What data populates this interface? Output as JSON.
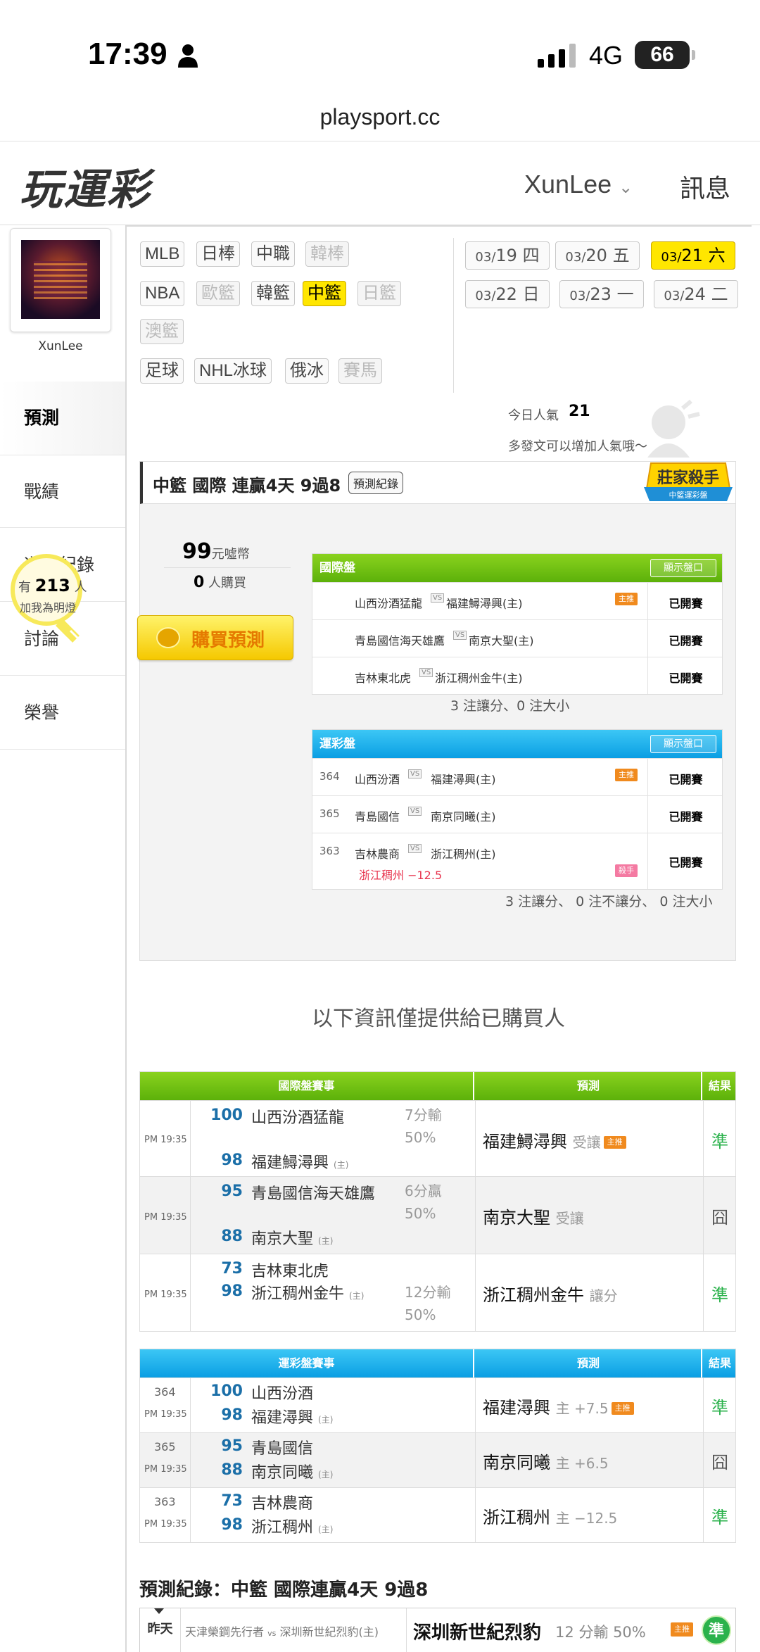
{
  "status_bar": {
    "time": "17:39",
    "network": "4G",
    "battery": "66"
  },
  "browser": {
    "url": "playsport.cc"
  },
  "header": {
    "logo": "玩運彩",
    "username": "XunLee",
    "username_chevron": "⌄",
    "messages": "訊息"
  },
  "sidebar": {
    "avatar_name": "XunLee",
    "items": [
      {
        "label": "預測"
      },
      {
        "label": "戰績"
      },
      {
        "label": "遊戲紀錄"
      },
      {
        "label": "討論"
      },
      {
        "label": "榮譽"
      }
    ],
    "fans_prefix": "有",
    "fans_count": "213",
    "fans_suffix": "人",
    "fans_hint": "加我為明燈"
  },
  "filters": {
    "row1": [
      "MLB",
      "日棒",
      "中職",
      "韓棒"
    ],
    "row2": [
      "NBA",
      "歐籃",
      "韓籃",
      "中籃",
      "日籃"
    ],
    "row3": [
      "澳籃"
    ],
    "row4": [
      "足球",
      "NHL冰球",
      "俄冰",
      "賽馬"
    ],
    "selected": "中籃"
  },
  "dates": [
    {
      "md": "03/",
      "d": "19",
      "w": "四"
    },
    {
      "md": "03/",
      "d": "20",
      "w": "五"
    },
    {
      "md": "03/",
      "d": "21",
      "w": "六"
    },
    {
      "md": "03/",
      "d": "22",
      "w": "日"
    },
    {
      "md": "03/",
      "d": "23",
      "w": "一"
    },
    {
      "md": "03/",
      "d": "24",
      "w": "二"
    }
  ],
  "popularity": {
    "label": "今日人氣",
    "value": "21",
    "hint": "多發文可以增加人氣哦～"
  },
  "card": {
    "title": "中籃 國際 連贏4天 9過8",
    "record_tag": "預測紀錄",
    "badge": "莊家殺手",
    "badge_sub": "中籃運彩盤",
    "price": "99",
    "price_unit": "元噓幣",
    "buyers": "0",
    "buyers_unit": "人購買",
    "buy_button": "購買預測"
  },
  "intl_table": {
    "title": "國際盤",
    "show": "顯示盤口",
    "rows": [
      {
        "a": "山西汾酒猛龍",
        "b": "福建鱘潯興(主)",
        "res": "已開賽",
        "home": "主推"
      },
      {
        "a": "青島國信海天雄鷹",
        "b": "南京大聖(主)",
        "res": "已開賽"
      },
      {
        "a": "吉林東北虎",
        "b": "浙江稠州金牛(主)",
        "res": "已開賽"
      }
    ],
    "totals": "3 注讓分、0 注大小"
  },
  "lottery_table": {
    "title": "運彩盤",
    "show": "顯示盤口",
    "rows": [
      {
        "num": "364",
        "a": "山西汾酒",
        "b": "福建潯興(主)",
        "res": "已開賽",
        "home": "主推"
      },
      {
        "num": "365",
        "a": "青島國信",
        "b": "南京同曦(主)",
        "res": "已開賽"
      },
      {
        "num": "363",
        "a": "吉林農商",
        "b": "浙江稠州(主)",
        "res": "已開賽",
        "line": "浙江稠州 −12.5",
        "home": "殺手"
      }
    ],
    "totals": "3 注讓分、 0 注不讓分、 0 注大小"
  },
  "info_only": "以下資訊僅提供給已購買人",
  "vs": "VS",
  "intl_results": {
    "headers": [
      "國際盤賽事",
      "預測",
      "結果"
    ],
    "rows": [
      {
        "time": "PM 19:35",
        "s1": "100",
        "t1": "山西汾酒猛龍",
        "s2": "98",
        "t2": "福建鱘潯興",
        "l1": "7分輸",
        "l2": "50%",
        "pick": "福建鱘潯興",
        "pick_note": "受讓",
        "home": "主推",
        "res": "準"
      },
      {
        "time": "PM 19:35",
        "s1": "95",
        "t1": "青島國信海天雄鷹",
        "s2": "88",
        "t2": "南京大聖",
        "l1": "6分贏",
        "l2": "50%",
        "pick": "南京大聖",
        "pick_note": "受讓",
        "res": "囧"
      },
      {
        "time": "PM 19:35",
        "s1": "73",
        "t1": "吉林東北虎",
        "s2": "98",
        "t2": "浙江稠州金牛",
        "l1": "12分輸",
        "l2": "50%",
        "pick": "浙江稠州金牛",
        "pick_note": "讓分",
        "res": "準"
      }
    ]
  },
  "lottery_results": {
    "headers": [
      "運彩盤賽事",
      "預測",
      "結果"
    ],
    "rows": [
      {
        "num": "364",
        "time": "PM 19:35",
        "s1": "100",
        "t1": "山西汾酒",
        "s2": "98",
        "t2": "福建潯興",
        "pick": "福建潯興",
        "pick_note": "主 +7.5",
        "home": "主推",
        "res": "準"
      },
      {
        "num": "365",
        "time": "PM 19:35",
        "s1": "95",
        "t1": "青島國信",
        "s2": "88",
        "t2": "南京同曦",
        "pick": "南京同曦",
        "pick_note": "主 +6.5",
        "res": "囧"
      },
      {
        "num": "363",
        "time": "PM 19:35",
        "s1": "73",
        "t1": "吉林農商",
        "s2": "98",
        "t2": "浙江稠州",
        "pick": "浙江稠州",
        "pick_note": "主 −12.5",
        "res": "準"
      }
    ]
  },
  "home_mark": "(主)",
  "record": {
    "title": "預測紀錄：中籃 國際連贏4天 9過8",
    "day": "昨天",
    "match_a": "天津榮鋼先行者",
    "vs": "vs",
    "match_b": "深圳新世紀烈豹(主)",
    "pick": "深圳新世紀烈豹",
    "line": "12 分輸 50%",
    "home": "主推",
    "res": "準"
  }
}
